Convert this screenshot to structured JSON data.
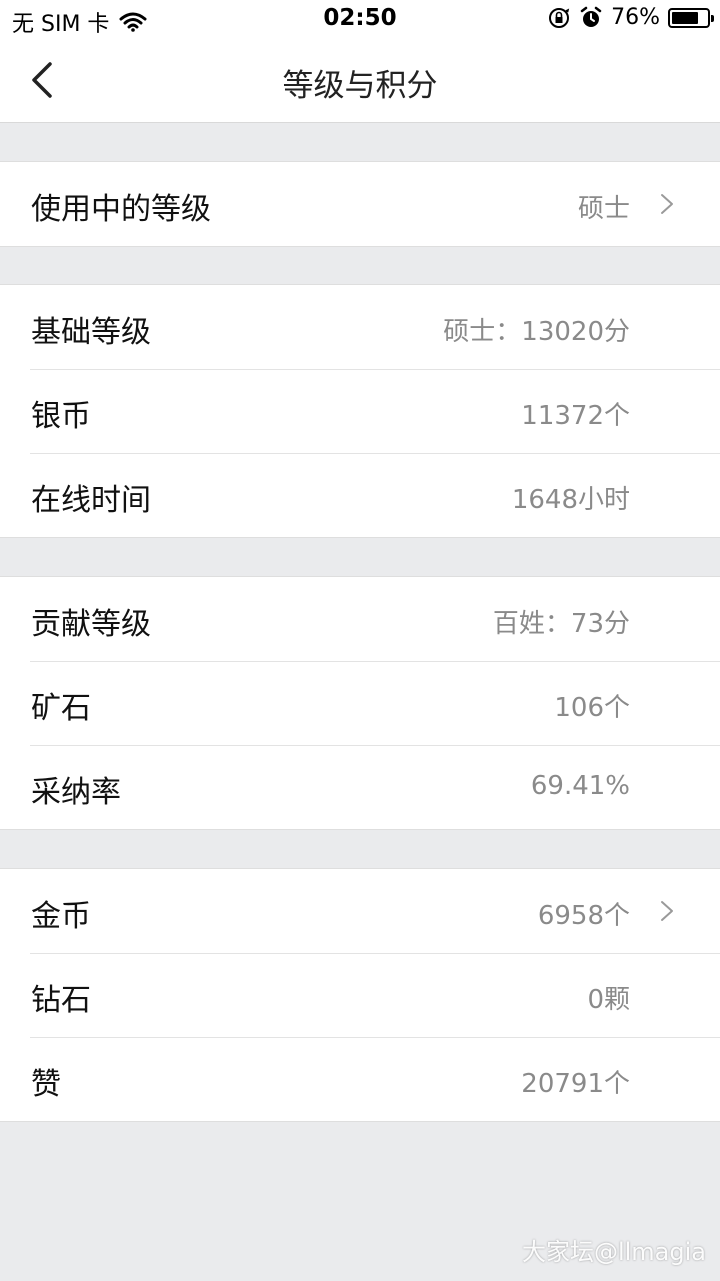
{
  "status_bar": {
    "carrier": "无 SIM 卡",
    "time": "02:50",
    "battery_percent": "76%",
    "battery_level": 0.76,
    "icons": [
      "wifi-icon",
      "orientation-lock-icon",
      "alarm-icon",
      "battery-icon"
    ]
  },
  "nav": {
    "title": "等级与积分",
    "back_icon": "chevron-left-icon"
  },
  "sections": [
    {
      "rows": [
        {
          "label": "使用中的等级",
          "value": "硕士",
          "has_chevron": true
        }
      ]
    },
    {
      "rows": [
        {
          "label": "基础等级",
          "value": "硕士：13020分",
          "has_chevron": false
        },
        {
          "label": "银币",
          "value": "11372个",
          "has_chevron": false
        },
        {
          "label": "在线时间",
          "value": "1648小时",
          "has_chevron": false
        }
      ]
    },
    {
      "rows": [
        {
          "label": "贡献等级",
          "value": "百姓：73分",
          "has_chevron": false
        },
        {
          "label": "矿石",
          "value": "106个",
          "has_chevron": false
        },
        {
          "label": "采纳率",
          "value": "69.41%",
          "has_chevron": false
        }
      ]
    },
    {
      "rows": [
        {
          "label": "金币",
          "value": "6958个",
          "has_chevron": true
        },
        {
          "label": "钻石",
          "value": "0颗",
          "has_chevron": false
        },
        {
          "label": "赞",
          "value": "20791个",
          "has_chevron": false
        }
      ]
    }
  ],
  "watermark": "大家坛@llmagia"
}
